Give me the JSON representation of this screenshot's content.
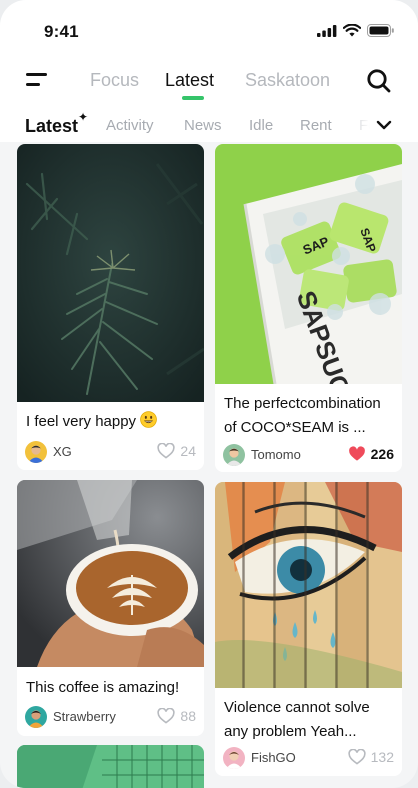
{
  "status": {
    "time": "9:41"
  },
  "nav": {
    "tabs": [
      "Focus",
      "Latest",
      "Saskatoon"
    ],
    "active": "Latest"
  },
  "categories": {
    "items": [
      "Latest",
      "Activity",
      "News",
      "Idle",
      "Rent",
      "Fo"
    ],
    "active": "Latest",
    "active_mark": "✦"
  },
  "posts": [
    {
      "title": "I feel very happy",
      "emoji": "grinning-face-emoji",
      "user": "XG",
      "likes": "24",
      "liked": false
    },
    {
      "title": "The perfectcombination of COCO*SEAM is ...",
      "user": "Tomomo",
      "likes": "226",
      "liked": true
    },
    {
      "title": "This coffee is amazing!",
      "user": "Strawberry",
      "likes": "88",
      "liked": false
    },
    {
      "title": "Violence cannot solve any problem Yeah...",
      "user": "FishGO",
      "likes": "132",
      "liked": false
    }
  ],
  "images": {
    "post1": "pine-branch-photo",
    "post2": "cooler-box-with-sapsucker-cans-photo",
    "post3": "latte-art-pour-photo",
    "post4": "graffiti-eye-on-wooden-fence-photo",
    "post5": "green-tiled-wall-photo"
  },
  "colors": {
    "accent": "#35c46a",
    "liked_heart": "#ef4a5a",
    "inactive": "#b5b8bd"
  }
}
